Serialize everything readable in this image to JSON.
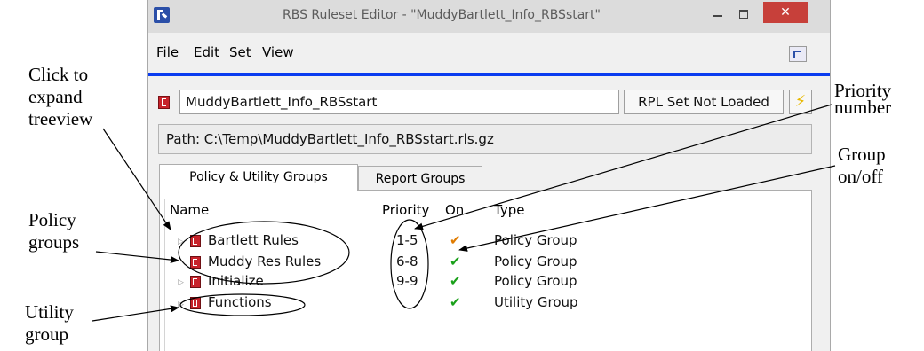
{
  "annotations": {
    "expand": [
      "Click to",
      "expand",
      "treeview"
    ],
    "priority": [
      "Priority",
      "number"
    ],
    "group_onoff": [
      "Group",
      "on/off"
    ],
    "policy": [
      "Policy",
      "groups"
    ],
    "utility": [
      "Utility",
      "group"
    ]
  },
  "window": {
    "title": "RBS Ruleset Editor - \"MuddyBartlett_Info_RBSstart\"",
    "minimize": "–",
    "maximize": "□",
    "close": "✕"
  },
  "menu": {
    "file": "File",
    "edit": "Edit",
    "set": "Set",
    "view": "View"
  },
  "ruleset": {
    "name": "MuddyBartlett_Info_RBSstart",
    "rpl_status": "RPL Set Not Loaded",
    "lightning": "⚡",
    "path": "Path:  C:\\Temp\\MuddyBartlett_Info_RBSstart.rls.gz"
  },
  "tabs": {
    "policy_utility": "Policy & Utility Groups",
    "report": "Report Groups"
  },
  "columns": {
    "name": "Name",
    "priority": "Priority",
    "on": "On",
    "type": "Type"
  },
  "rows": [
    {
      "name": "Bartlett Rules",
      "priority": "1-5",
      "check": "✔",
      "type": "Policy Group"
    },
    {
      "name": "Muddy Res Rules",
      "priority": "6-8",
      "check": "✔",
      "type": "Policy Group"
    },
    {
      "name": "Initialize",
      "priority": "9-9",
      "check": "✔",
      "type": "Policy Group"
    },
    {
      "name": "Functions",
      "priority": "",
      "check": "✔",
      "type": "Utility Group"
    }
  ],
  "colors": {
    "check_on_first": "#e07b00",
    "check_on": "#1aa01a",
    "accent_blue": "#0a3cf0",
    "close_red": "#c7403a"
  }
}
